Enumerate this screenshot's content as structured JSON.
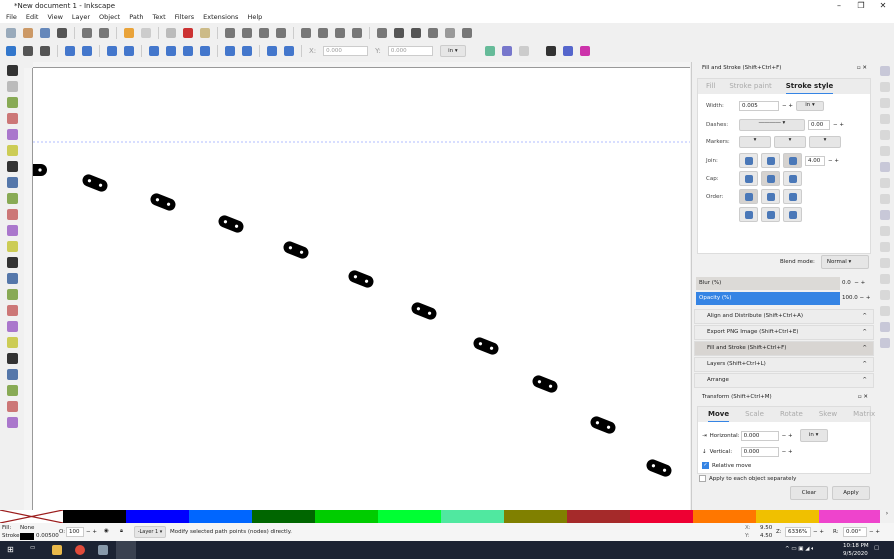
{
  "window": {
    "title": "*New document 1 - Inkscape",
    "min": "–",
    "max": "❐",
    "close": "✕"
  },
  "menu": [
    "File",
    "Edit",
    "View",
    "Layer",
    "Object",
    "Path",
    "Text",
    "Filters",
    "Extensions",
    "Help"
  ],
  "node_toolbar": {
    "x_label": "X:",
    "x_value": "0.000",
    "y_label": "Y:",
    "y_value": "0.000",
    "unit": "in"
  },
  "fill_stroke": {
    "title": "Fill and Stroke (Shift+Ctrl+F)",
    "tabs": [
      "Fill",
      "Stroke paint",
      "Stroke style"
    ],
    "active_tab": "Stroke style",
    "width_label": "Width:",
    "width_value": "0.005",
    "width_unit": "in",
    "dashes_label": "Dashes:",
    "dashes_value": "0.00",
    "markers_label": "Markers:",
    "join_label": "Join:",
    "miter_value": "4.00",
    "cap_label": "Cap:",
    "order_label": "Order:",
    "blend_label": "Blend mode:",
    "blend_value": "Normal",
    "blur_label": "Blur (%)",
    "blur_value": "0.0",
    "opacity_label": "Opacity (%)",
    "opacity_value": "100.0"
  },
  "docks": [
    "Align and Distribute (Shift+Ctrl+A)",
    "Export PNG Image (Shift+Ctrl+E)",
    "Fill and Stroke (Shift+Ctrl+F)",
    "Layers (Shift+Ctrl+L)",
    "Arrange"
  ],
  "transform": {
    "title": "Transform (Shift+Ctrl+M)",
    "tabs": [
      "Move",
      "Scale",
      "Rotate",
      "Skew",
      "Matrix"
    ],
    "horizontal_label": "Horizontal:",
    "horizontal_value": "0.000",
    "unit": "in",
    "vertical_label": "Vertical:",
    "vertical_value": "0.000",
    "relative_move": "Relative move",
    "relative_checked": true,
    "apply_each": "Apply to each object separately",
    "apply_each_checked": false,
    "clear": "Clear",
    "apply": "Apply"
  },
  "palette": [
    "#000000",
    "#0000ff",
    "#0066ff",
    "#006600",
    "#00cc00",
    "#00ff33",
    "#50e8a0",
    "#808000",
    "#a52a2a",
    "#ee0033",
    "#ff7700",
    "#f0c000",
    "#ee44cc"
  ],
  "status": {
    "fill_label": "Fill:",
    "fill_value": "None",
    "stroke_label": "Stroke:",
    "stroke_width": "0.00500",
    "opacity_label": "O:",
    "opacity_value": "100",
    "layer": "-Layer 1",
    "message": "Modify selected path points (nodes) directly.",
    "x_label": "X:",
    "x_value": "9.50",
    "y_label": "Y:",
    "y_value": "4.50",
    "zoom_label": "Z:",
    "zoom_value": "6336%",
    "rot_label": "R:",
    "rot_value": "0.00°"
  },
  "taskbar": {
    "time": "10:18 PM",
    "date": "9/5/2020"
  }
}
